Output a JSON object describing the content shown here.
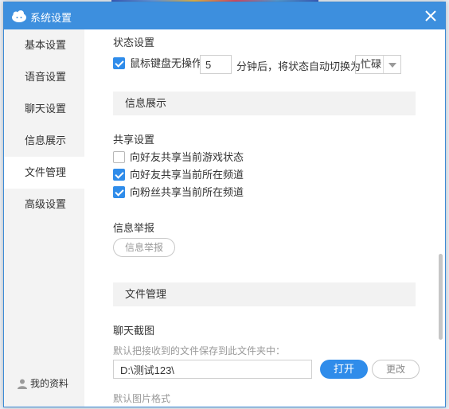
{
  "window": {
    "title": "系统设置"
  },
  "sidebar": {
    "items": [
      {
        "label": "基本设置",
        "active": false
      },
      {
        "label": "语音设置",
        "active": false
      },
      {
        "label": "聊天设置",
        "active": false
      },
      {
        "label": "信息展示",
        "active": false
      },
      {
        "label": "文件管理",
        "active": true
      },
      {
        "label": "高级设置",
        "active": false
      }
    ],
    "profile_label": "我的资料"
  },
  "status": {
    "heading": "状态设置",
    "checkbox_checked": true,
    "label_before": "鼠标键盘无操作",
    "minutes": "5",
    "label_after": "分钟后，将状态自动切换为",
    "selected_status": "忙碌"
  },
  "info_section": {
    "band_title": "信息展示",
    "share": {
      "heading": "共享设置",
      "options": [
        {
          "label": "向好友共享当前游戏状态",
          "checked": false
        },
        {
          "label": "向好友共享当前所在频道",
          "checked": true
        },
        {
          "label": "向粉丝共享当前所在频道",
          "checked": true
        }
      ]
    },
    "report": {
      "heading": "信息举报",
      "button_label": "信息举报"
    }
  },
  "file_section": {
    "band_title": "文件管理",
    "screenshot": {
      "heading": "聊天截图",
      "hint": "默认把接收到的文件保存到此文件夹中：",
      "path": "D:\\测试123\\",
      "open_label": "打开",
      "change_label": "更改"
    },
    "image_format_label": "默认图片格式"
  },
  "colors": {
    "titlebar": "#3d8fde",
    "accent": "#2f8cea"
  }
}
